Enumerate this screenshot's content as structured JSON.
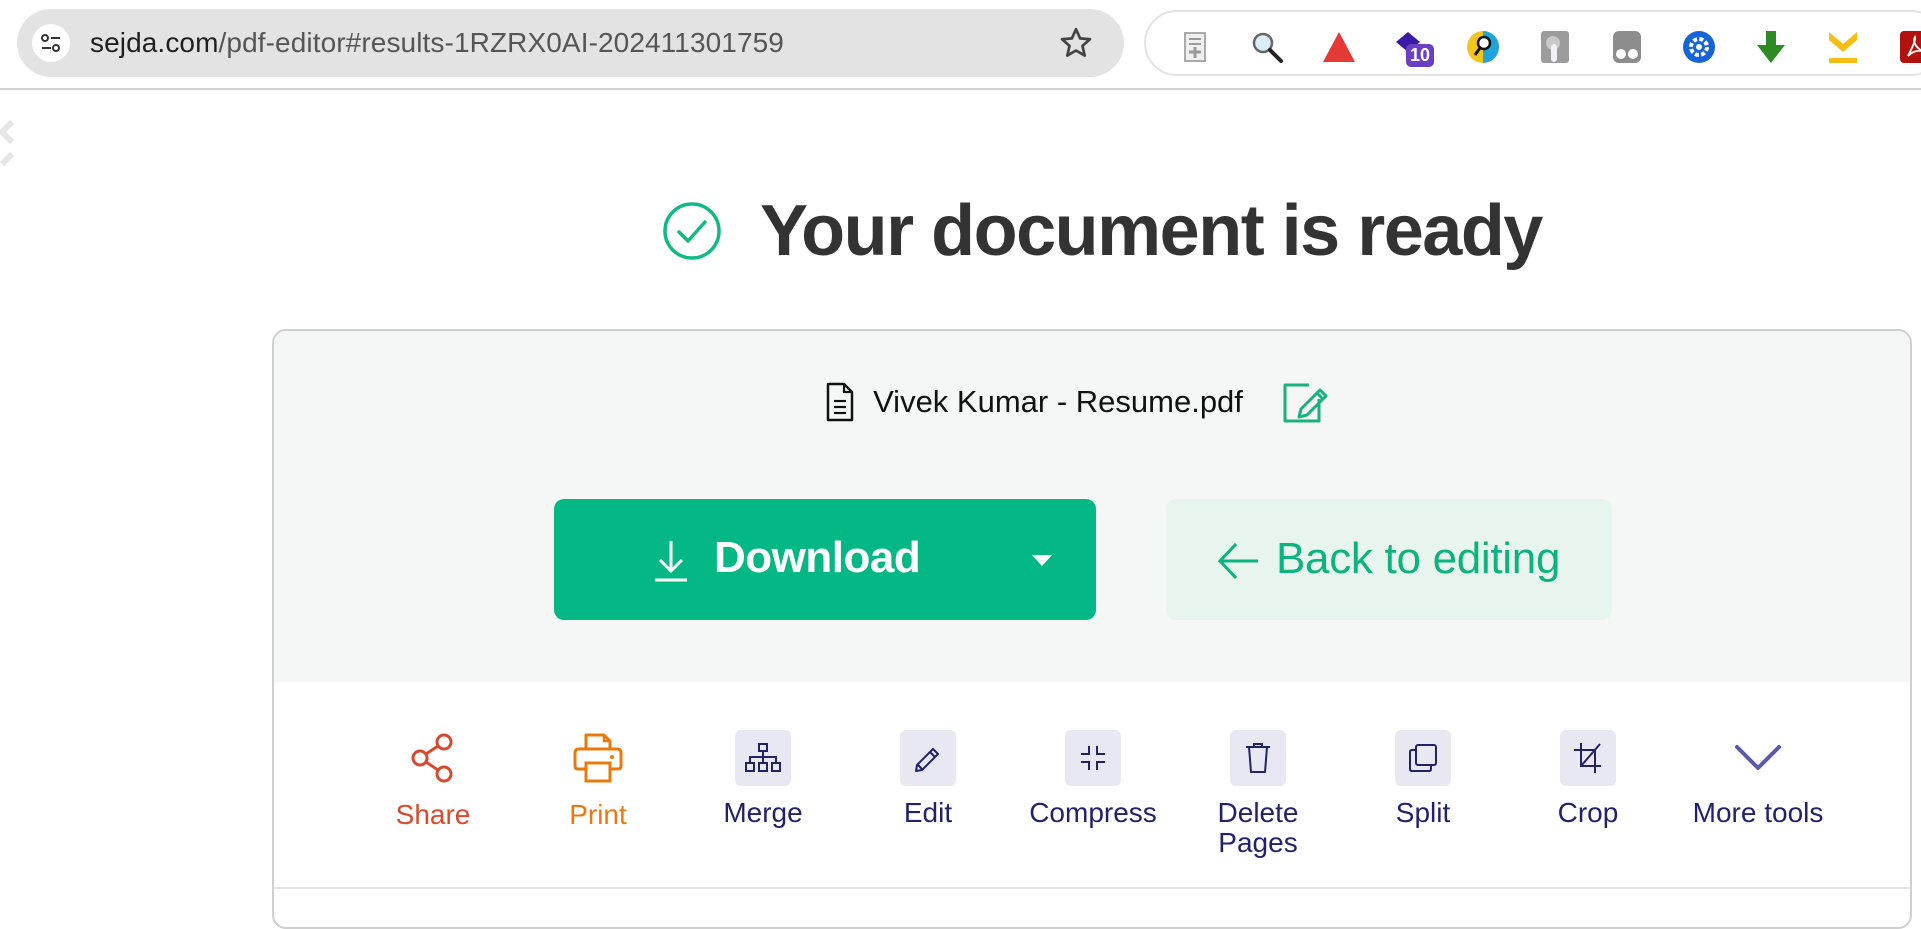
{
  "browser": {
    "url_host": "sejda.com",
    "url_path": "/pdf-editor#results-1RZRX0AI-202411301759",
    "extensions": [
      {
        "name": "reader-mode-extension",
        "badge": ""
      },
      {
        "name": "search-extension",
        "badge": ""
      },
      {
        "name": "red-triangle-extension",
        "badge": ""
      },
      {
        "name": "graduation-cap-extension",
        "badge": "10"
      },
      {
        "name": "magnifier-extension",
        "badge": ""
      },
      {
        "name": "touch-extension",
        "badge": ""
      },
      {
        "name": "dual-circle-extension",
        "badge": ""
      },
      {
        "name": "gear-badge-extension",
        "badge": ""
      },
      {
        "name": "download-arrow-extension",
        "badge": ""
      },
      {
        "name": "yellow-download-extension",
        "badge": ""
      },
      {
        "name": "adobe-pdf-extension",
        "badge": ""
      }
    ]
  },
  "page": {
    "heading": "Your document is ready",
    "file_name": "Vivek Kumar - Resume.pdf",
    "download_label": "Download",
    "back_label": "Back to editing",
    "tools": [
      {
        "id": "share",
        "label": "Share",
        "icon": "share-icon"
      },
      {
        "id": "print",
        "label": "Print",
        "icon": "printer-icon"
      },
      {
        "id": "merge",
        "label": "Merge",
        "icon": "sitemap-icon"
      },
      {
        "id": "edit",
        "label": "Edit",
        "icon": "pencil-icon"
      },
      {
        "id": "compress",
        "label": "Compress",
        "icon": "compress-icon"
      },
      {
        "id": "delete-pages",
        "label": "Delete Pages",
        "icon": "trash-icon"
      },
      {
        "id": "split",
        "label": "Split",
        "icon": "copy-icon"
      },
      {
        "id": "crop",
        "label": "Crop",
        "icon": "crop-icon"
      },
      {
        "id": "more-tools",
        "label": "More tools",
        "icon": "chevron-down-icon"
      }
    ]
  },
  "colors": {
    "brand_green": "#04b885",
    "back_bg": "#e8f4ee",
    "share": "#d8492f",
    "print": "#e87a0d",
    "tool_text": "#22226b"
  }
}
